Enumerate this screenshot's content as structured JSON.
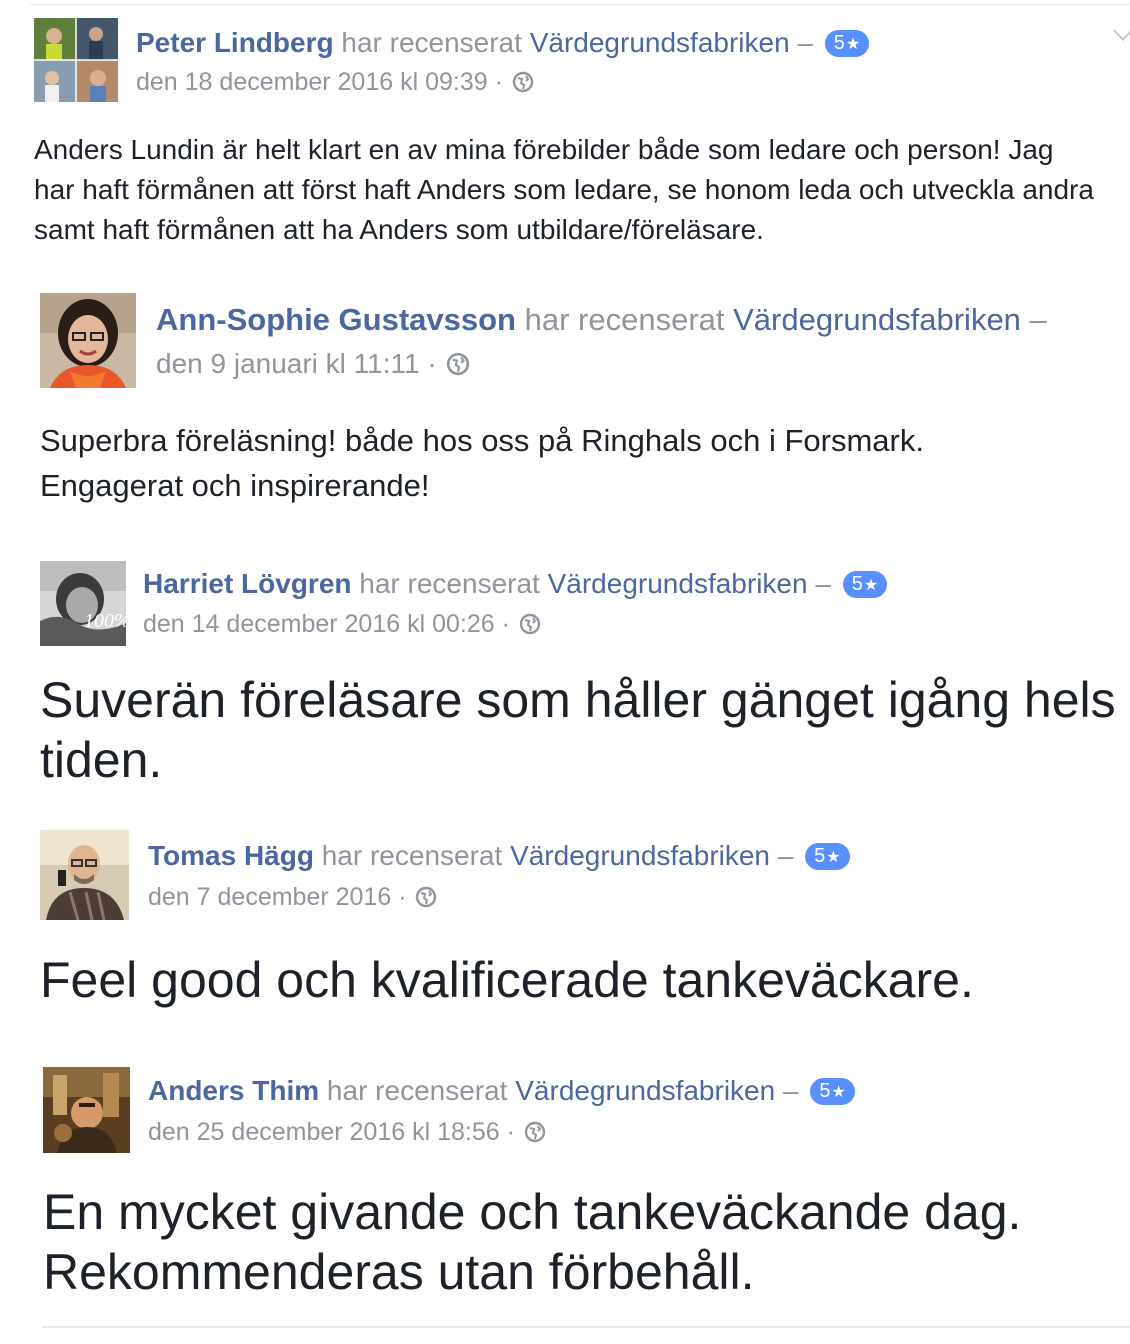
{
  "reviews": [
    {
      "author": "Peter Lindberg",
      "verb": "har recenserat",
      "page": "Värdegrundsfabriken",
      "dash": "–",
      "rating": "5",
      "star": "★",
      "date": "den 18 december 2016 kl 09:39",
      "separator": "·",
      "privacy_icon": "globe-icon",
      "text": "Anders Lundin är helt klart en av mina förebilder både som ledare och person! Jag har haft förmånen att först haft Anders som ledare, se honom leda och utveckla andra samt haft förmånen att ha Anders som utbildare/föreläsare."
    },
    {
      "author": "Ann-Sophie Gustavsson",
      "verb": "har recenserat",
      "page": "Värdegrundsfabriken",
      "dash": "–",
      "date": "den 9 januari kl 11:11",
      "separator": "·",
      "privacy_icon": "globe-icon",
      "text": "Superbra föreläsning! både hos oss på Ringhals och i Forsmark. Engagerat och inspirerande!"
    },
    {
      "author": "Harriet Lövgren",
      "verb": "har recenserat",
      "page": "Värdegrundsfabriken",
      "dash": "–",
      "rating": "5",
      "star": "★",
      "date": "den 14 december 2016 kl 00:26",
      "separator": "·",
      "privacy_icon": "globe-icon",
      "text": "Suverän föreläsare som håller gänget igång hels tiden."
    },
    {
      "author": "Tomas Hägg",
      "verb": "har recenserat",
      "page": "Värdegrundsfabriken",
      "dash": "–",
      "rating": "5",
      "star": "★",
      "date": "den 7 december 2016",
      "separator": "·",
      "privacy_icon": "globe-icon",
      "text": "Feel good och kvalificerade tankeväckare."
    },
    {
      "author": "Anders Thim",
      "verb": "har recenserat",
      "page": "Värdegrundsfabriken",
      "dash": "–",
      "rating": "5",
      "star": "★",
      "date": "den 25 december 2016 kl 18:56",
      "separator": "·",
      "privacy_icon": "globe-icon",
      "text": "En mycket givande och tankeväckande dag. Rekommenderas utan förbehåll."
    }
  ],
  "colors": {
    "link": "#4b67a1",
    "meta": "#90949c",
    "badge": "#5890ff",
    "text": "#1d2129"
  }
}
